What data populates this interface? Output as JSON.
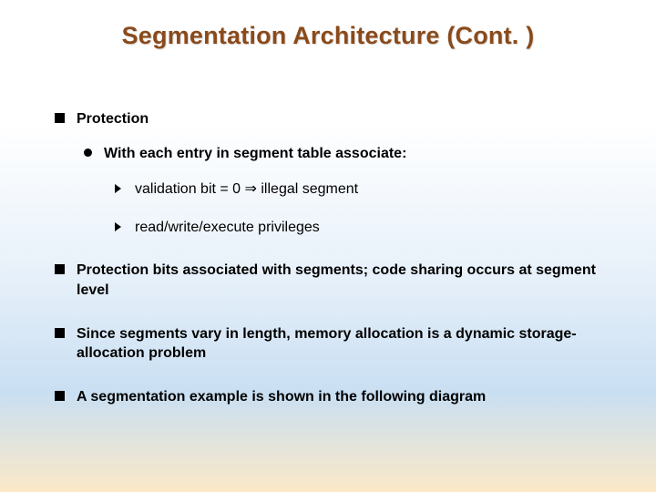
{
  "title": "Segmentation Architecture (Cont. )",
  "bullets": {
    "b1": "Protection",
    "b1_1": "With each entry in segment table associate:",
    "b1_1_a": "validation bit = 0 ⇒ illegal segment",
    "b1_1_b": "read/write/execute privileges",
    "b2": "Protection bits associated with segments; code sharing occurs at segment level",
    "b3": "Since segments vary in length, memory allocation is a dynamic storage-allocation problem",
    "b4": "A segmentation example is shown in the following diagram"
  }
}
